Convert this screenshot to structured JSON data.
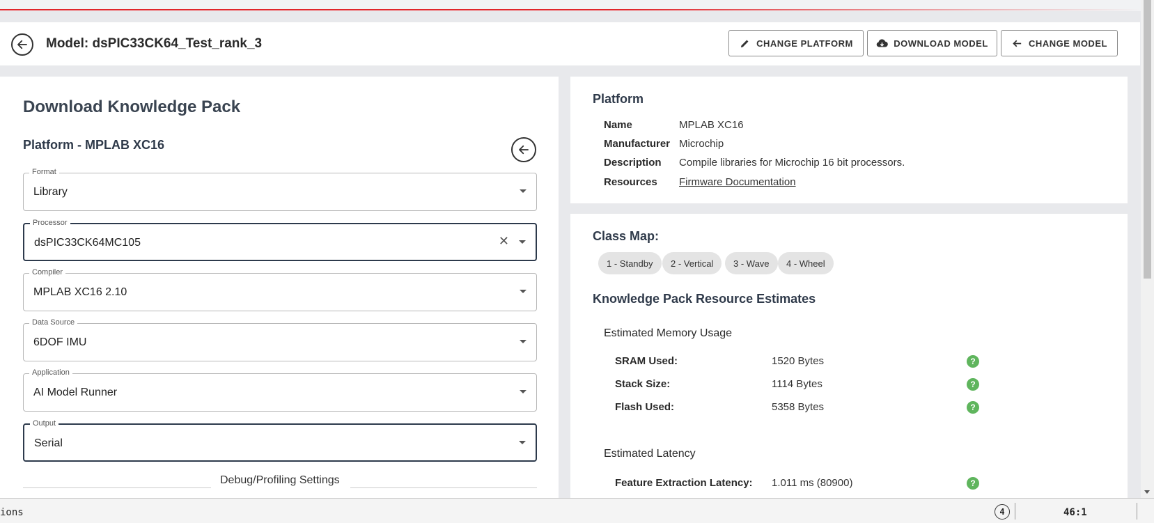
{
  "header": {
    "title": "Model: dsPIC33CK64_Test_rank_3",
    "buttons": {
      "change_platform": "CHANGE PLATFORM",
      "download_model": "DOWNLOAD MODEL",
      "change_model": "CHANGE MODEL"
    }
  },
  "download": {
    "title": "Download Knowledge Pack",
    "platform_heading": "Platform - MPLAB XC16",
    "fields": {
      "format": {
        "label": "Format",
        "value": "Library"
      },
      "processor": {
        "label": "Processor",
        "value": "dsPIC33CK64MC105"
      },
      "compiler": {
        "label": "Compiler",
        "value": "MPLAB XC16 2.10"
      },
      "data_source": {
        "label": "Data Source",
        "value": "6DOF IMU"
      },
      "application": {
        "label": "Application",
        "value": "AI Model Runner"
      },
      "output": {
        "label": "Output",
        "value": "Serial"
      }
    },
    "debug_label": "Debug/Profiling Settings"
  },
  "platform": {
    "title": "Platform",
    "name_key": "Name",
    "name_val": "MPLAB XC16",
    "manufacturer_key": "Manufacturer",
    "manufacturer_val": "Microchip",
    "description_key": "Description",
    "description_val": "Compile libraries for Microchip 16 bit processors.",
    "resources_key": "Resources",
    "resources_val": "Firmware Documentation"
  },
  "classmap": {
    "title": "Class Map:",
    "chips": [
      "1 - Standby",
      "2 - Vertical",
      "3 - Wave",
      "4 - Wheel"
    ]
  },
  "estimates": {
    "title": "Knowledge Pack Resource Estimates",
    "memory_title": "Estimated Memory Usage",
    "sram_key": "SRAM Used:",
    "sram_val": "1520 Bytes",
    "stack_key": "Stack Size:",
    "stack_val": "1114 Bytes",
    "flash_key": "Flash Used:",
    "flash_val": "5358 Bytes",
    "latency_title": "Estimated Latency",
    "fe_key": "Feature Extraction Latency:",
    "fe_val": "1.011 ms (80900)"
  },
  "statusbar": {
    "left_text": "ions",
    "count": "4",
    "position": "46:1"
  },
  "icons": {
    "help": "?",
    "clear": "✕"
  },
  "colors": {
    "accent_red": "#e0252b",
    "help_green": "#5fb55d",
    "heading": "#2f3a4a"
  }
}
